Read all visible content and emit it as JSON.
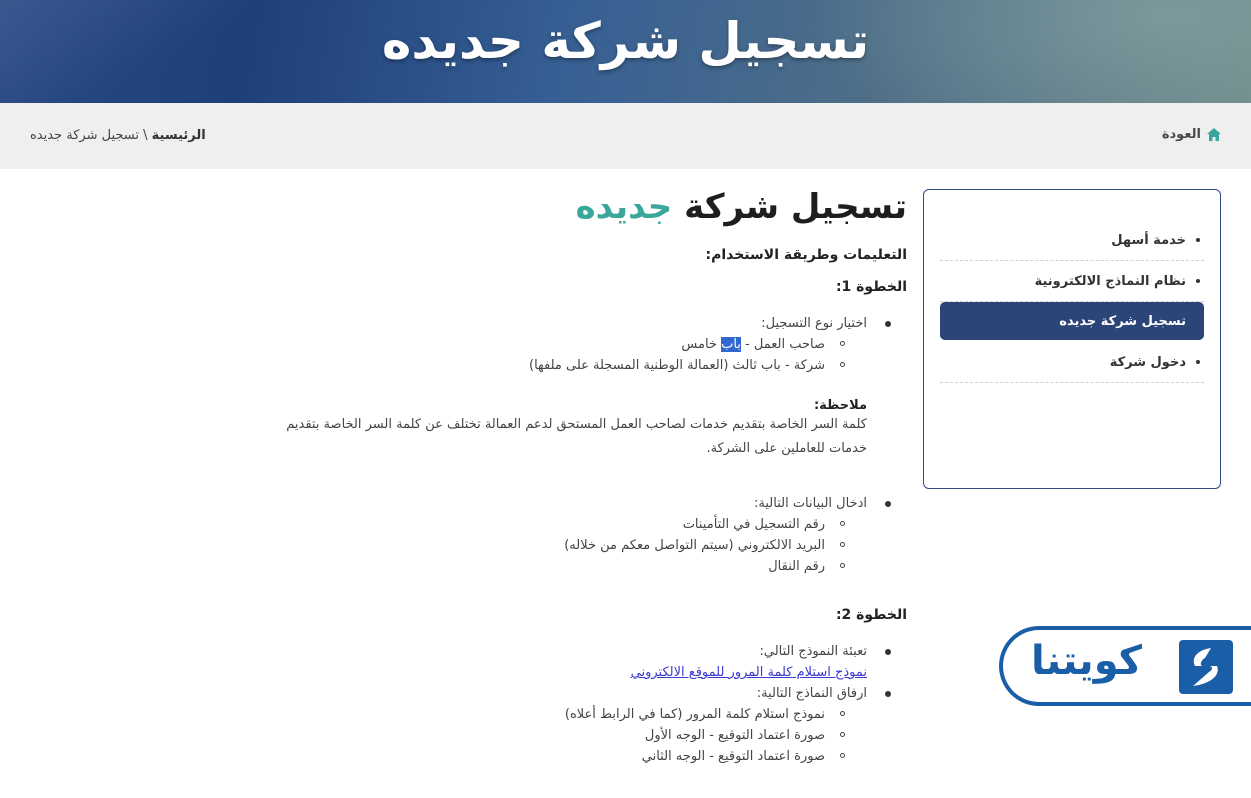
{
  "banner": {
    "title": "تسجيل شركة جديده"
  },
  "breadcrumb": {
    "back_label": "العودة",
    "home_label": "الرئيسية",
    "separator": "\\",
    "current": "تسجيل شركة جديده"
  },
  "sidebar": {
    "items": [
      {
        "label": "خدمة أسهل",
        "active": false
      },
      {
        "label": "نظام النماذج الالكترونية",
        "active": false
      },
      {
        "label": "تسجيل شركة جديده",
        "active": true
      },
      {
        "label": "دخول شركة",
        "active": false
      }
    ]
  },
  "content": {
    "title_main": "تسجيل شركة",
    "title_accent": "جديده",
    "instructions_head": "التعليمات وطريقة الاستخدام:",
    "step1_head": "الخطوة 1:",
    "step1_choose": "اختيار نوع التسجيل:",
    "step1_opt1_pre": "صاحب العمل - ",
    "step1_opt1_hl": "باب",
    "step1_opt1_post": " خامس",
    "step1_opt2": "شركة - باب ثالث (العمالة الوطنية المسجلة على ملفها)",
    "note_head": "ملاحظة:",
    "note_line1": "كلمة السر الخاصة بتقديم خدمات لصاحب العمل المستحق لدعم العمالة تختلف عن كلمة السر الخاصة بتقديم",
    "note_line2": "خدمات للعاملين على الشركة.",
    "step1_enter": "ادخال البيانات التالية:",
    "step1_field1": "رقم التسجيل في التأمينات",
    "step1_field2": "البريد الالكتروني (سيتم التواصل معكم من خلاله)",
    "step1_field3": "رقم النقال",
    "step2_head": "الخطوة 2:",
    "step2_fill": "تعبئة النموذج التالي:",
    "step2_link": "نموذج استلام كلمة المرور للموقع الالكتروني",
    "step2_attach": "ارفاق النماذج التالية:",
    "step2_doc1": "نموذج استلام كلمة المرور (كما في الرابط أعلاه)",
    "step2_doc2": "صورة اعتماد التوقيع - الوجه الأول",
    "step2_doc3": "صورة اعتماد التوقيع - الوجه الثاني"
  },
  "logo": {
    "text": "كويتنا",
    "color": "#1a5ea8"
  },
  "colors": {
    "accent": "#3ba79b",
    "nav_active": "#2b4579"
  }
}
